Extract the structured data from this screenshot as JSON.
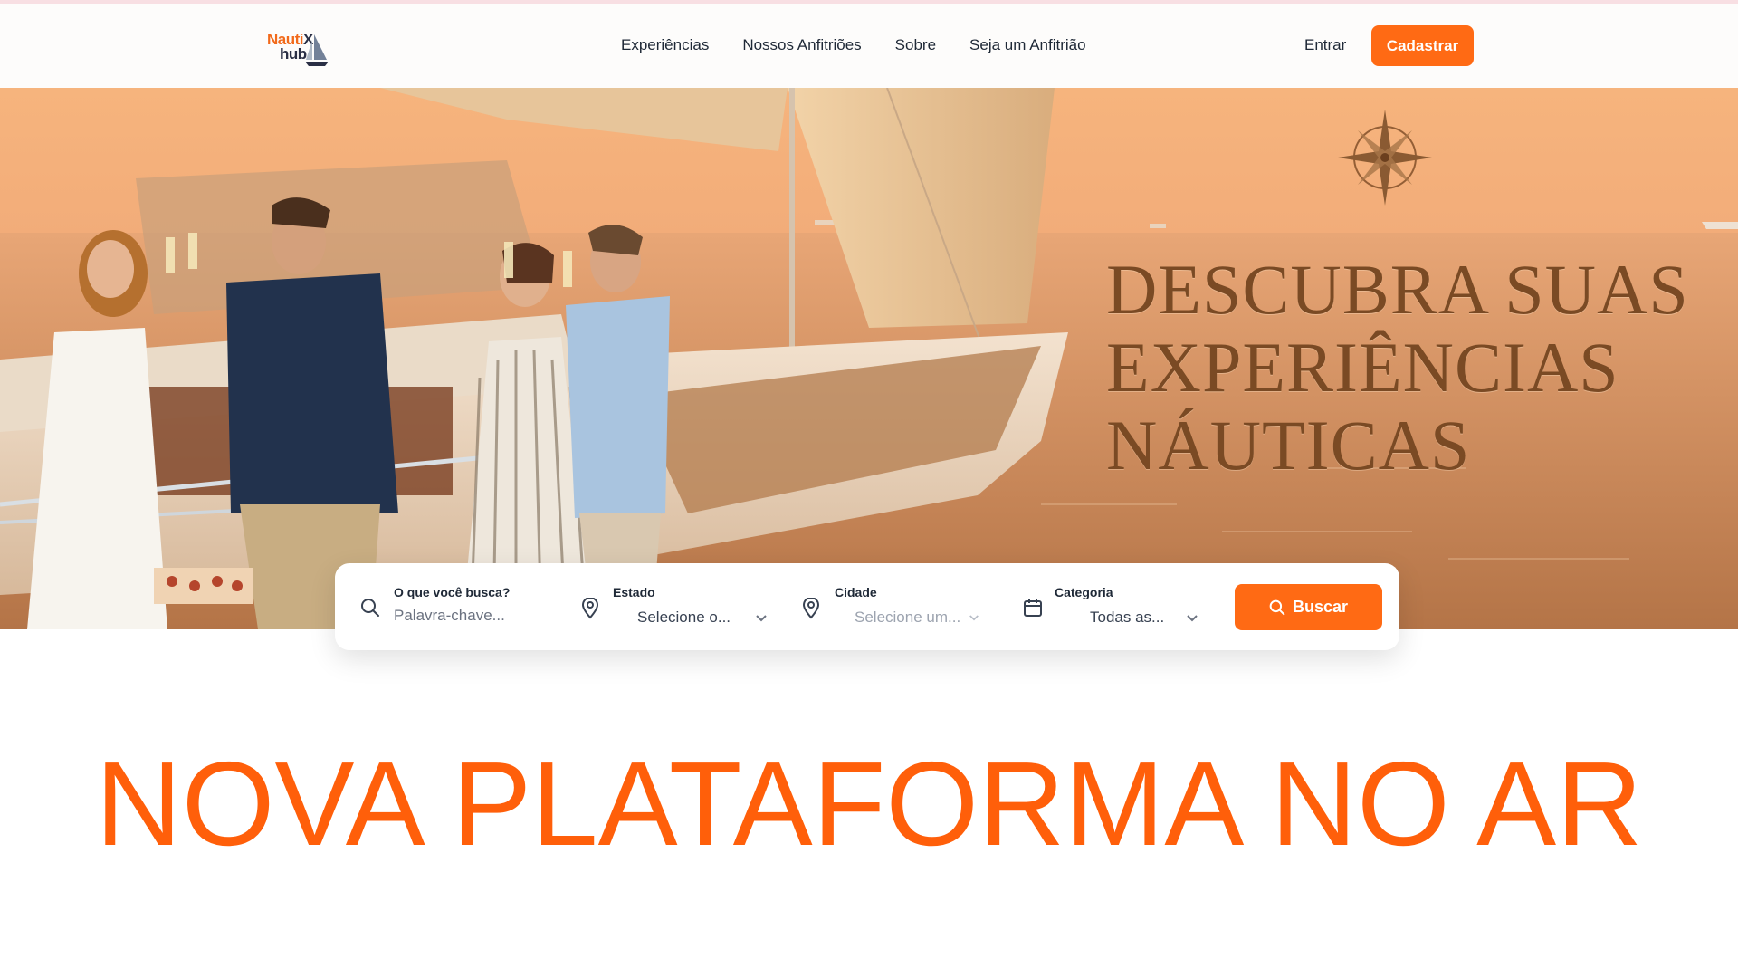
{
  "brand": {
    "logo_line1": "Nauti",
    "logo_x": "X",
    "logo_line2": "hub"
  },
  "nav": {
    "links": [
      "Experiências",
      "Nossos Anfitriões",
      "Sobre",
      "Seja um Anfitrião"
    ],
    "signin": "Entrar",
    "signup": "Cadastrar"
  },
  "hero": {
    "headline": [
      "DESCUBRA SUAS",
      "EXPERIÊNCIAS",
      "NÁUTICAS"
    ]
  },
  "search": {
    "keyword": {
      "label": "O que você busca?",
      "placeholder": "Palavra-chave..."
    },
    "state": {
      "label": "Estado",
      "value": "Selecione o..."
    },
    "city": {
      "label": "Cidade",
      "value": "Selecione um..."
    },
    "category": {
      "label": "Categoria",
      "value": "Todas as..."
    },
    "button": "Buscar"
  },
  "banner": "NOVA PLATAFORMA NO AR",
  "colors": {
    "accent": "#ff6a14",
    "headline": "#7a4a24",
    "banner": "#ff5f0a"
  }
}
